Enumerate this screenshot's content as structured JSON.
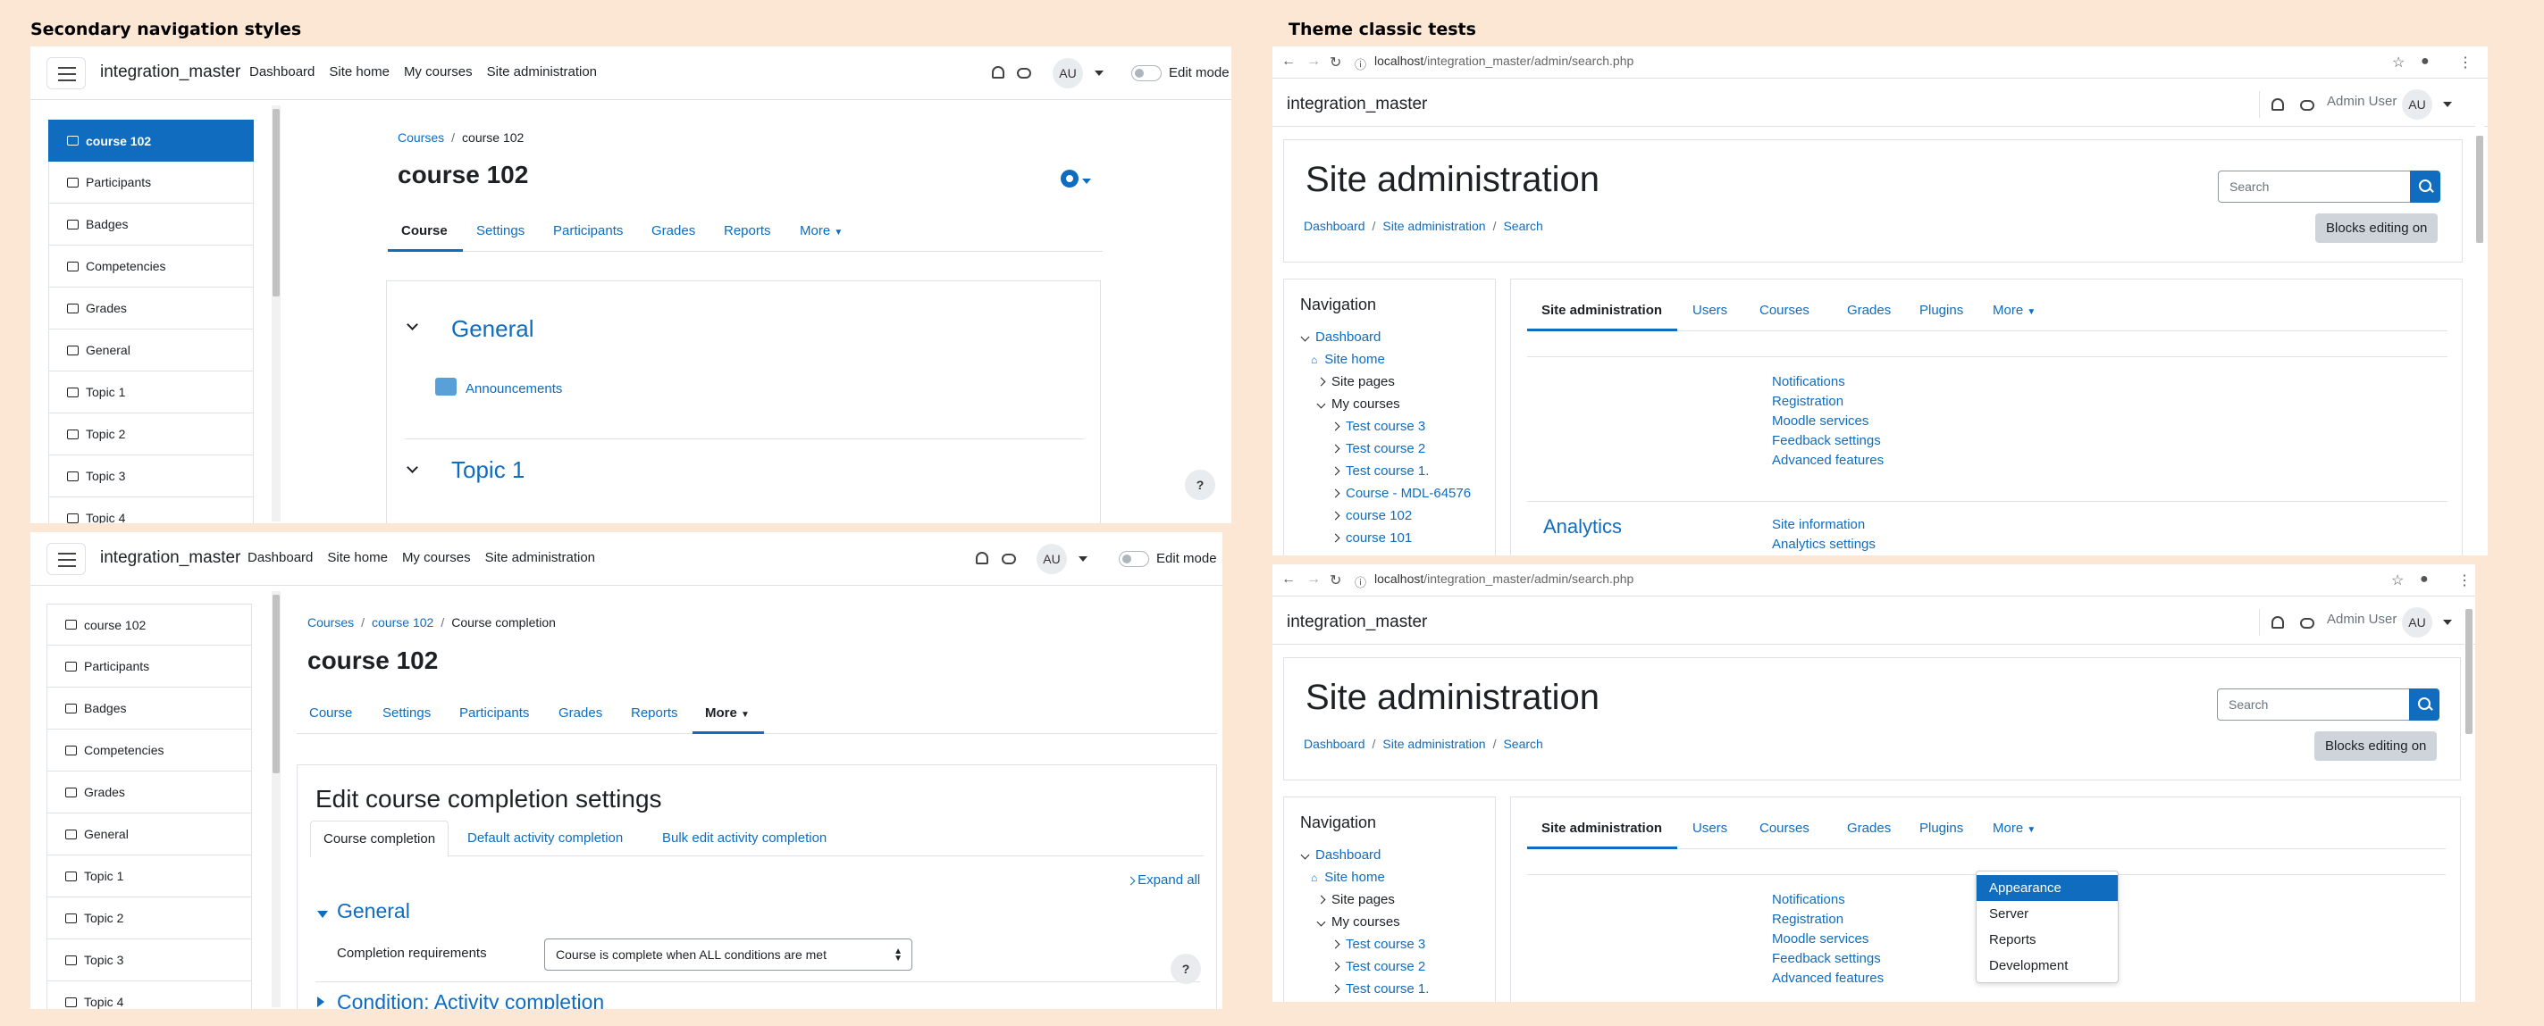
{
  "titles": {
    "left": "Secondary navigation styles",
    "right": "Theme classic tests"
  },
  "moodle": {
    "brand": "integration_master",
    "nav": [
      "Dashboard",
      "Site home",
      "My courses",
      "Site administration"
    ],
    "avatar": "AU",
    "edit_mode": "Edit mode"
  },
  "course_index": [
    "course 102",
    "Participants",
    "Badges",
    "Competencies",
    "Grades",
    "General",
    "Topic 1",
    "Topic 2",
    "Topic 3",
    "Topic 4"
  ],
  "p1": {
    "crumbs": [
      "Courses",
      "course 102"
    ],
    "title": "course 102",
    "tabs": [
      "Course",
      "Settings",
      "Participants",
      "Grades",
      "Reports",
      "More"
    ],
    "section1": "General",
    "activity": "Announcements",
    "section2": "Topic 1",
    "help": "?"
  },
  "p2": {
    "crumbs": [
      "Courses",
      "course 102",
      "Course completion"
    ],
    "title": "course 102",
    "tabs": [
      "Course",
      "Settings",
      "Participants",
      "Grades",
      "Reports",
      "More"
    ],
    "heading": "Edit course completion settings",
    "subtabs": [
      "Course completion",
      "Default activity completion",
      "Bulk edit activity completion"
    ],
    "expand": "Expand all",
    "section": "General",
    "req_label": "Completion requirements",
    "req_value": "Course is complete when ALL conditions are met",
    "section2": "Condition: Activity completion",
    "help": "?"
  },
  "classic": {
    "url_host": "localhost",
    "url_path": "/integration_master/admin/search.php",
    "brand": "integration_master",
    "user": "Admin User",
    "avatar": "AU",
    "heading": "Site administration",
    "search_placeholder": "Search",
    "crumbs": [
      "Dashboard",
      "Site administration",
      "Search"
    ],
    "blocks_btn": "Blocks editing on",
    "nav_title": "Navigation",
    "tree": [
      "Dashboard",
      "Site home",
      "Site pages",
      "My courses",
      "Test course 3",
      "Test course 2",
      "Test course 1.",
      "Course - MDL-64576",
      "course 102",
      "course 101"
    ],
    "tabs": [
      "Site administration",
      "Users",
      "Courses",
      "Grades",
      "Plugins",
      "More"
    ],
    "links": [
      "Notifications",
      "Registration",
      "Moodle services",
      "Feedback settings",
      "Advanced features"
    ],
    "analytics": "Analytics",
    "analytics_links": [
      "Site information",
      "Analytics settings"
    ],
    "dropdown": [
      "Appearance",
      "Server",
      "Reports",
      "Development"
    ]
  },
  "colors": {
    "accent": "#0f6cbf",
    "background": "#fce6d4"
  }
}
